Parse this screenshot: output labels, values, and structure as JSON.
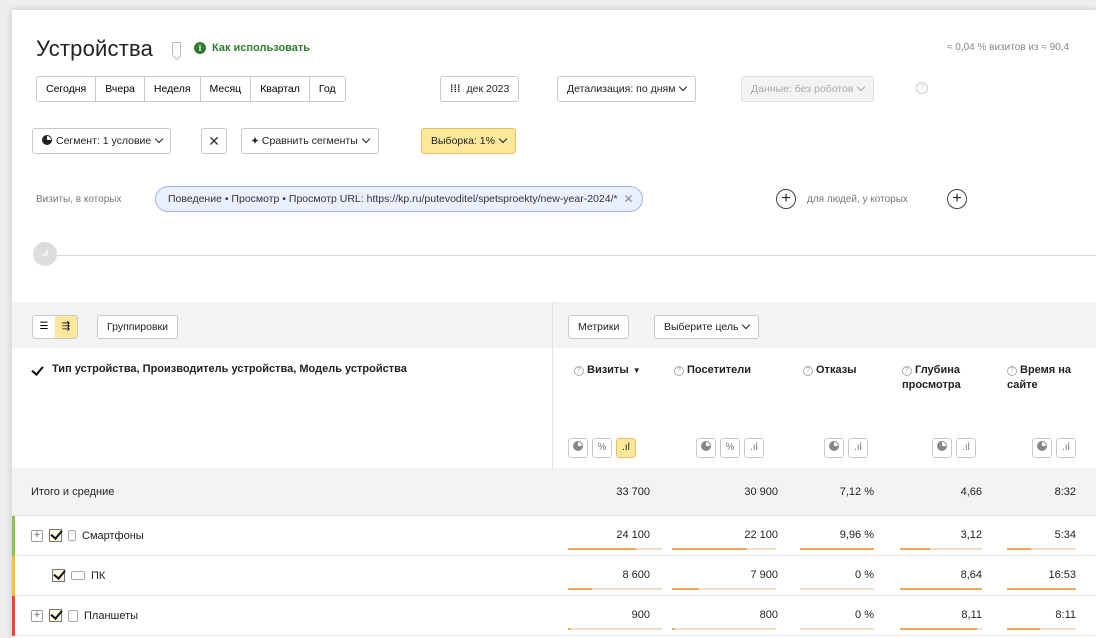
{
  "header": {
    "title": "Устройства",
    "howto": "Как использовать",
    "sample_info": "≈ 0,04 % визитов из ≈ 90,4"
  },
  "period_buttons": [
    "Сегодня",
    "Вчера",
    "Неделя",
    "Месяц",
    "Квартал",
    "Год"
  ],
  "date_button": "дек 2023",
  "detail_button": "Детализация: по дням",
  "data_button": "Данные: без роботов",
  "segment": {
    "label": "Сегмент: 1 условие",
    "compare": "Сравнить сегменты",
    "sampling": "Выборка: 1%"
  },
  "filter": {
    "visits_prefix": "Визиты, в которых",
    "chip": "Поведение • Просмотр • Просмотр URL: https://kp.ru/putevoditel/spetsproekty/new-year-2024/*",
    "people_label": "для людей, у которых"
  },
  "toolbar": {
    "groupings": "Группировки",
    "metrics": "Метрики",
    "goal": "Выберите цель"
  },
  "table": {
    "dimension_header": "Тип устройства, Производитель устройства, Модель устройства",
    "columns": [
      {
        "label": "Визиты",
        "sort": "▼"
      },
      {
        "label": "Посетители"
      },
      {
        "label": "Отказы"
      },
      {
        "label": "Глубина просмотра"
      },
      {
        "label": "Время на сайте"
      }
    ],
    "total": {
      "label": "Итого и средние",
      "values": [
        "33 700",
        "30 900",
        "7,12 %",
        "4,66",
        "8:32"
      ]
    },
    "rows": [
      {
        "label": "Смартфоны",
        "strip": "#8bc34a",
        "values": [
          "24 100",
          "22 100",
          "9,96 %",
          "3,12",
          "5:34"
        ],
        "fills": [
          0.72,
          0.72,
          1.0,
          0.36,
          0.35
        ]
      },
      {
        "label": "ПК",
        "strip": "#fbc02d",
        "values": [
          "8 600",
          "7 900",
          "0 %",
          "8,64",
          "16:53"
        ],
        "fills": [
          0.26,
          0.26,
          0,
          1.0,
          1.0
        ]
      },
      {
        "label": "Планшеты",
        "strip": "#f44336",
        "values": [
          "900",
          "800",
          "0 %",
          "8,11",
          "8:11"
        ],
        "fills": [
          0.03,
          0.03,
          0,
          0.94,
          0.48
        ]
      }
    ]
  },
  "colors": {
    "accent_yellow": "#fde79b",
    "bar": "#f5a65b",
    "green": "#2e7d32"
  }
}
